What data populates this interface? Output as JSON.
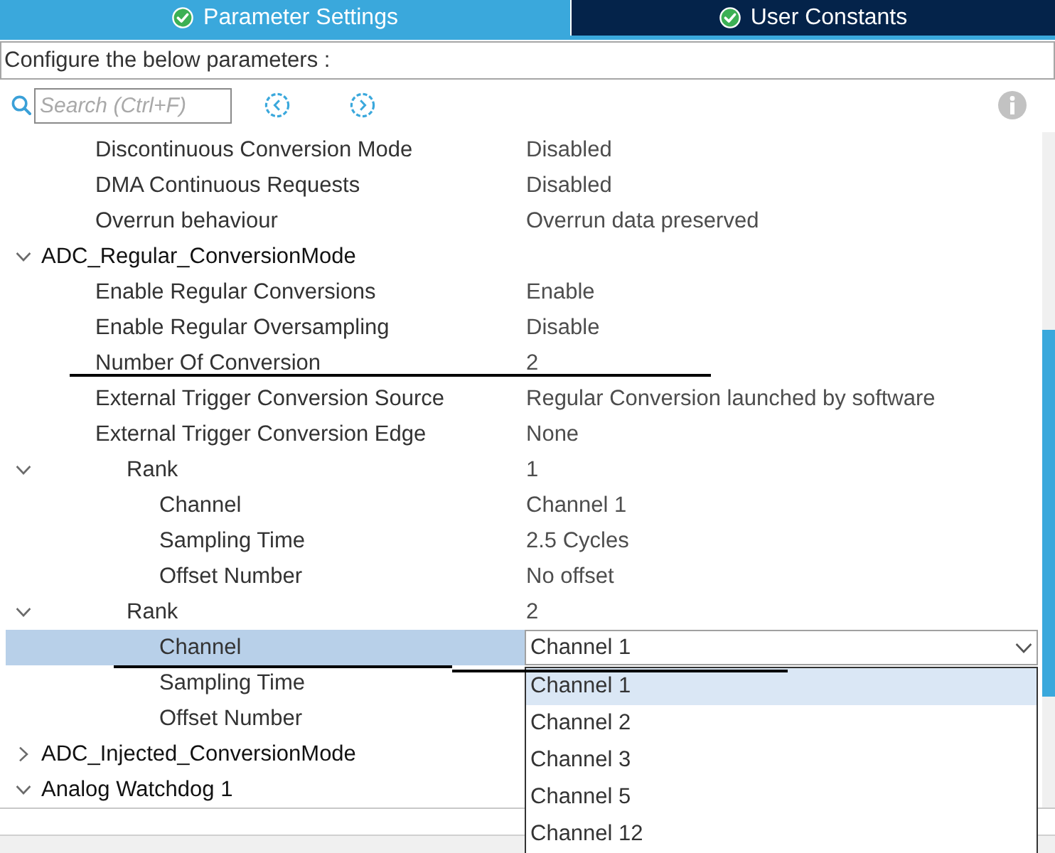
{
  "tabs": [
    {
      "label": "Parameter Settings",
      "selected": true
    },
    {
      "label": "User Constants",
      "selected": false
    }
  ],
  "description": "Configure the below parameters :",
  "search": {
    "placeholder": "Search (Ctrl+F)"
  },
  "tree": [
    {
      "children": [
        {
          "label": "Discontinuous Conversion Mode",
          "value": "Disabled",
          "selected": false
        },
        {
          "label": "DMA Continuous Requests",
          "value": "Disabled",
          "selected": false
        },
        {
          "label": "Overrun behaviour",
          "value": "Overrun data preserved",
          "selected": false
        }
      ]
    },
    {
      "label": "ADC_Regular_ConversionMode",
      "expanded": true,
      "selected": false,
      "children": [
        {
          "label": "Enable Regular Conversions",
          "value": "Enable",
          "selected": false
        },
        {
          "label": "Enable Regular Oversampling",
          "value": "Disable",
          "selected": false
        },
        {
          "label": "Number Of Conversion",
          "value": "2",
          "selected": false
        },
        {
          "label": "External Trigger Conversion Source",
          "value": "Regular Conversion launched by software",
          "selected": false
        },
        {
          "label": "External Trigger Conversion Edge",
          "value": "None",
          "selected": false
        },
        {
          "label": "Rank",
          "value": "1",
          "expanded": true,
          "selected": false,
          "children": [
            {
              "label": "Channel",
              "value": "Channel 1",
              "selected": false
            },
            {
              "label": "Sampling Time",
              "value": "2.5 Cycles",
              "selected": false
            },
            {
              "label": "Offset Number",
              "value": "No offset",
              "selected": false
            }
          ]
        },
        {
          "label": "Rank",
          "value": "2",
          "expanded": true,
          "selected": false,
          "children": [
            {
              "label": "Channel",
              "selected": true,
              "editor": {
                "kind": "dropdown",
                "value": "Channel 1",
                "open": true,
                "options": [
                  {
                    "label": "Channel 1",
                    "selected": true
                  },
                  {
                    "label": "Channel 2",
                    "selected": false
                  },
                  {
                    "label": "Channel 3",
                    "selected": false
                  },
                  {
                    "label": "Channel 5",
                    "selected": false
                  },
                  {
                    "label": "Channel 12",
                    "selected": false
                  }
                ]
              }
            },
            {
              "label": "Sampling Time",
              "selected": false
            },
            {
              "label": "Offset Number",
              "selected": false
            }
          ]
        }
      ]
    },
    {
      "label": "ADC_Injected_ConversionMode",
      "expanded": false,
      "selected": false
    },
    {
      "label": "Analog Watchdog 1",
      "expanded": true,
      "selected": false
    }
  ]
}
